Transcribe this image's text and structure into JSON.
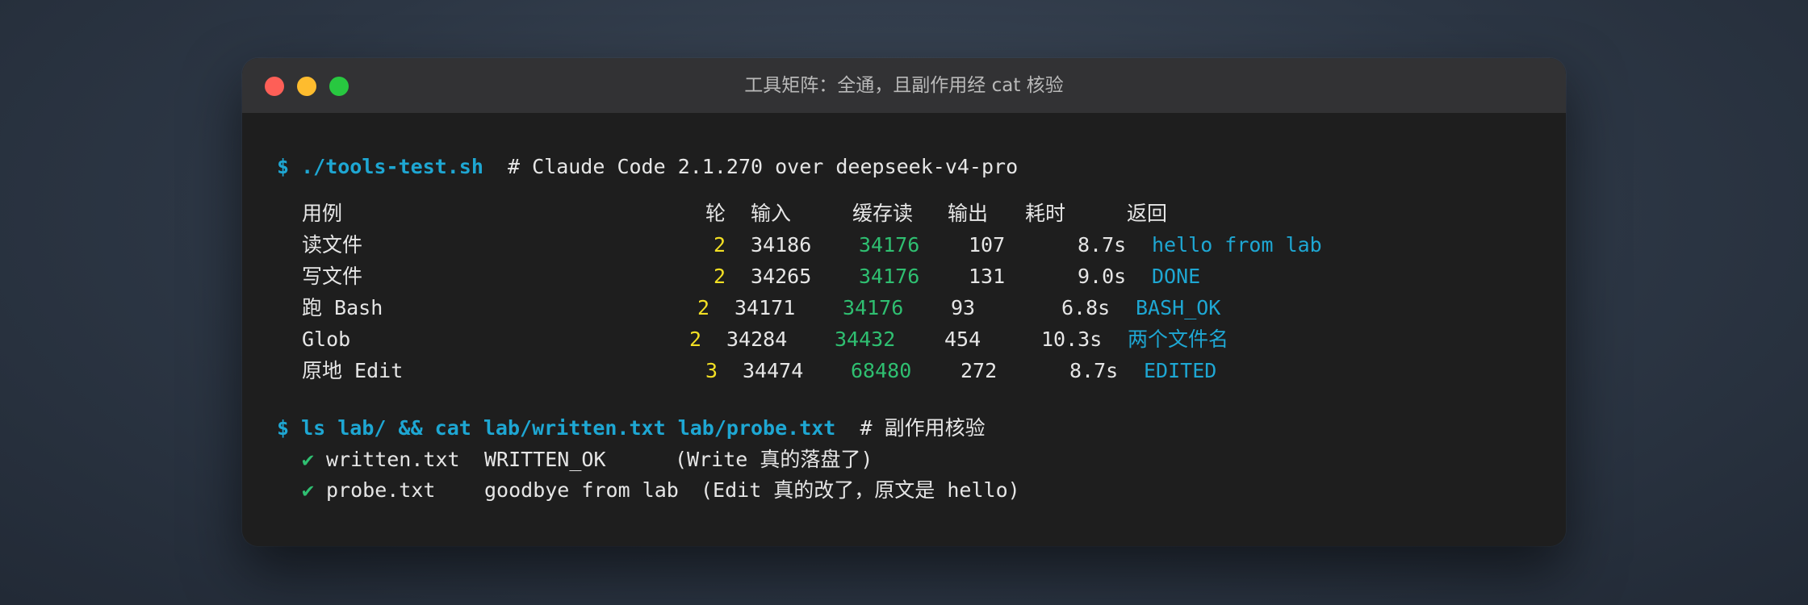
{
  "window": {
    "title": "工具矩阵：全通，且副作用经 cat 核验"
  },
  "commands": [
    {
      "prompt": "$ ./tools-test.sh",
      "comment": "# Claude Code 2.1.270 over deepseek-v4-pro"
    },
    {
      "prompt": "$ ls lab/ && cat lab/written.txt lab/probe.txt",
      "comment": "# 副作用核验"
    }
  ],
  "table": {
    "headers": [
      "用例",
      "轮",
      "输入",
      "缓存读",
      "输出",
      "耗时",
      "返回"
    ],
    "rows": [
      {
        "case": "读文件",
        "turns": "2",
        "input": "34186",
        "cache": "34176",
        "output": "107",
        "time": "8.7s",
        "result": "hello from lab"
      },
      {
        "case": "写文件",
        "turns": "2",
        "input": "34265",
        "cache": "34176",
        "output": "131",
        "time": "9.0s",
        "result": "DONE"
      },
      {
        "case": "跑 Bash",
        "turns": "2",
        "input": "34171",
        "cache": "34176",
        "output": "93",
        "time": "6.8s",
        "result": "BASH_OK"
      },
      {
        "case": "Glob",
        "turns": "2",
        "input": "34284",
        "cache": "34432",
        "output": "454",
        "time": "10.3s",
        "result": "两个文件名"
      },
      {
        "case": "原地 Edit",
        "turns": "3",
        "input": "34474",
        "cache": "68480",
        "output": "272",
        "time": "8.7s",
        "result": "EDITED"
      }
    ]
  },
  "verify": [
    {
      "mark": "✔",
      "file": "written.txt",
      "content": "WRITTEN_OK",
      "note": "(Write 真的落盘了)"
    },
    {
      "mark": "✔",
      "file": "probe.txt",
      "content": "goodbye from lab",
      "note": "(Edit 真的改了，原文是 hello)"
    }
  ]
}
